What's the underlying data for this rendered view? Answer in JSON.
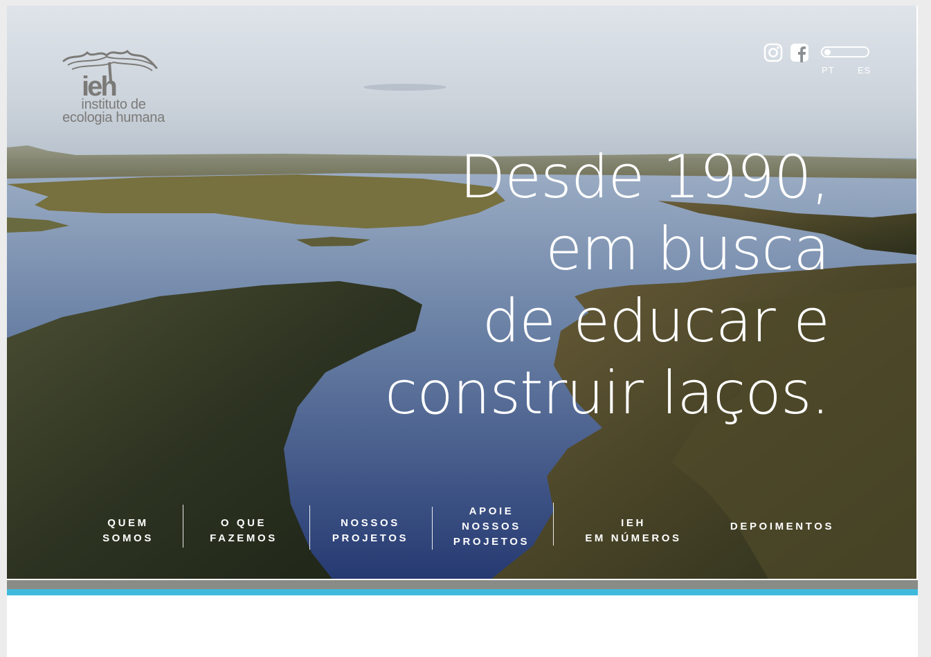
{
  "logo": {
    "mark": "ieh",
    "line1": "instituto de",
    "line2": "ecologia humana"
  },
  "social": {
    "instagram": "instagram-icon",
    "facebook": "facebook-icon"
  },
  "language": {
    "options": [
      "PT",
      "ES"
    ],
    "selected": "PT"
  },
  "headline": {
    "lines": [
      "Desde 1990,",
      "em busca",
      "de educar e",
      "construir laços."
    ]
  },
  "nav": {
    "items": [
      {
        "label": "QUEM\nSOMOS"
      },
      {
        "label": "O QUE\nFAZEMOS"
      },
      {
        "label": "NOSSOS\nPROJETOS"
      },
      {
        "label": "APOIE\nNOSSOS\nPROJETOS"
      },
      {
        "label": "IEH\nEM NÚMEROS"
      },
      {
        "label": "DEPOIMENTOS"
      }
    ]
  },
  "colors": {
    "accent_gray": "#898b86",
    "accent_blue": "#3fb9dc",
    "logo_gray": "#7b7a77"
  }
}
